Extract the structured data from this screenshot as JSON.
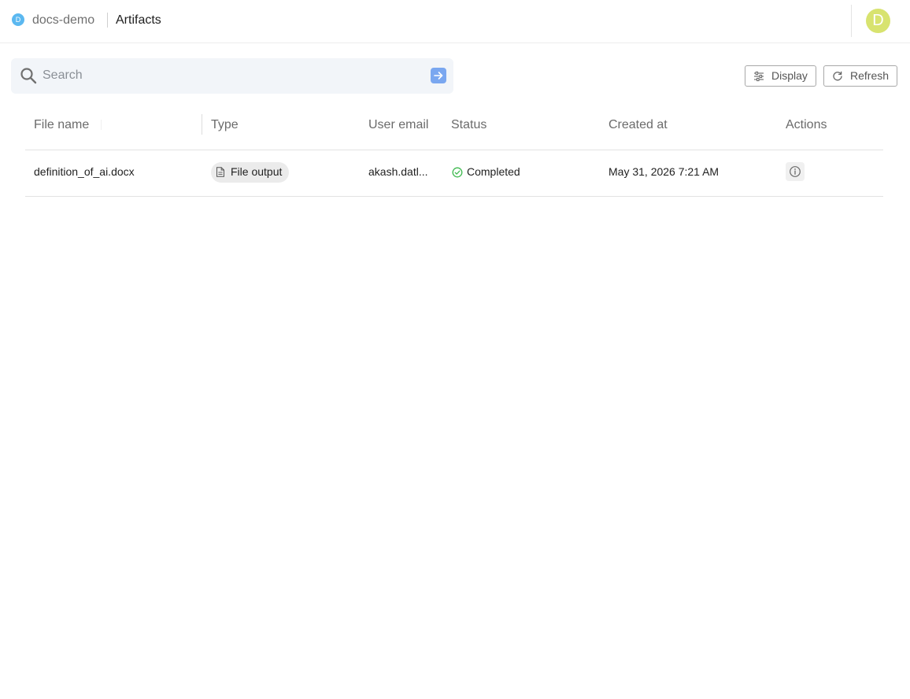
{
  "header": {
    "project_initial": "D",
    "project_name": "docs-demo",
    "page_title": "Artifacts",
    "avatar_initial": "D"
  },
  "search": {
    "placeholder": "Search",
    "value": ""
  },
  "toolbar": {
    "display_label": "Display",
    "refresh_label": "Refresh"
  },
  "table": {
    "columns": [
      "File name",
      "Type",
      "User email",
      "Status",
      "Created at",
      "Actions"
    ],
    "rows": [
      {
        "file_name": "definition_of_ai.docx",
        "type": "File output",
        "user_email": "akash.datl...",
        "status": "Completed",
        "created_at": "May 31, 2026 7:21 AM"
      }
    ]
  },
  "icons": {
    "project": "project-dot-icon",
    "search": "search-icon",
    "search_go": "arrow-right-icon",
    "display": "sliders-icon",
    "refresh": "refresh-icon",
    "type": "file-icon",
    "status": "check-circle-icon",
    "action": "info-icon"
  },
  "colors": {
    "accent": "#7aa7f0",
    "project_dot": "#5bb8f0",
    "avatar": "#d8e36f",
    "status_success": "#3fb950",
    "search_bg": "#f2f5f9"
  }
}
